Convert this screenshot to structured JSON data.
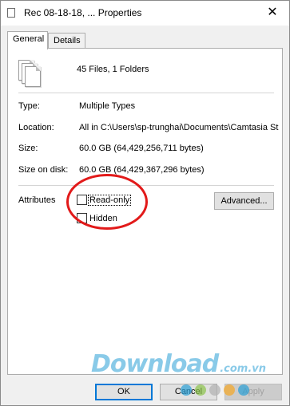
{
  "window": {
    "title": "Rec 08-18-18, ... Properties",
    "close_glyph": "✕"
  },
  "tabs": [
    {
      "label": "General",
      "active": true
    },
    {
      "label": "Details",
      "active": false
    }
  ],
  "summary": "45 Files, 1 Folders",
  "properties": [
    {
      "label": "Type:",
      "value": "Multiple Types"
    },
    {
      "label": "Location:",
      "value": "All in C:\\Users\\sp-trunghai\\Documents\\Camtasia St"
    },
    {
      "label": "Size:",
      "value": "60.0 GB (64,429,256,711 bytes)"
    },
    {
      "label": "Size on disk:",
      "value": "60.0 GB (64,429,367,296 bytes)"
    }
  ],
  "attributes": {
    "label": "Attributes",
    "read_only": {
      "label": "Read-only",
      "checked": false
    },
    "hidden": {
      "label": "Hidden",
      "checked": false
    },
    "advanced_label": "Advanced..."
  },
  "buttons": {
    "ok": "OK",
    "cancel": "Cancel",
    "apply": "Apply"
  },
  "watermark": {
    "brand": "Download",
    "domain": ".com.vn"
  },
  "colors": {
    "annotation_circle": "#e21a1a",
    "watermark": "#2a9fd6",
    "focus_border": "#0078d7",
    "dots": [
      "#2a9fd6",
      "#8bc34a",
      "#b0b0b0",
      "#f5a623",
      "#2a9fd6"
    ]
  },
  "icons": {
    "title": "properties-doc-icon",
    "files": "multiple-files-icon"
  }
}
